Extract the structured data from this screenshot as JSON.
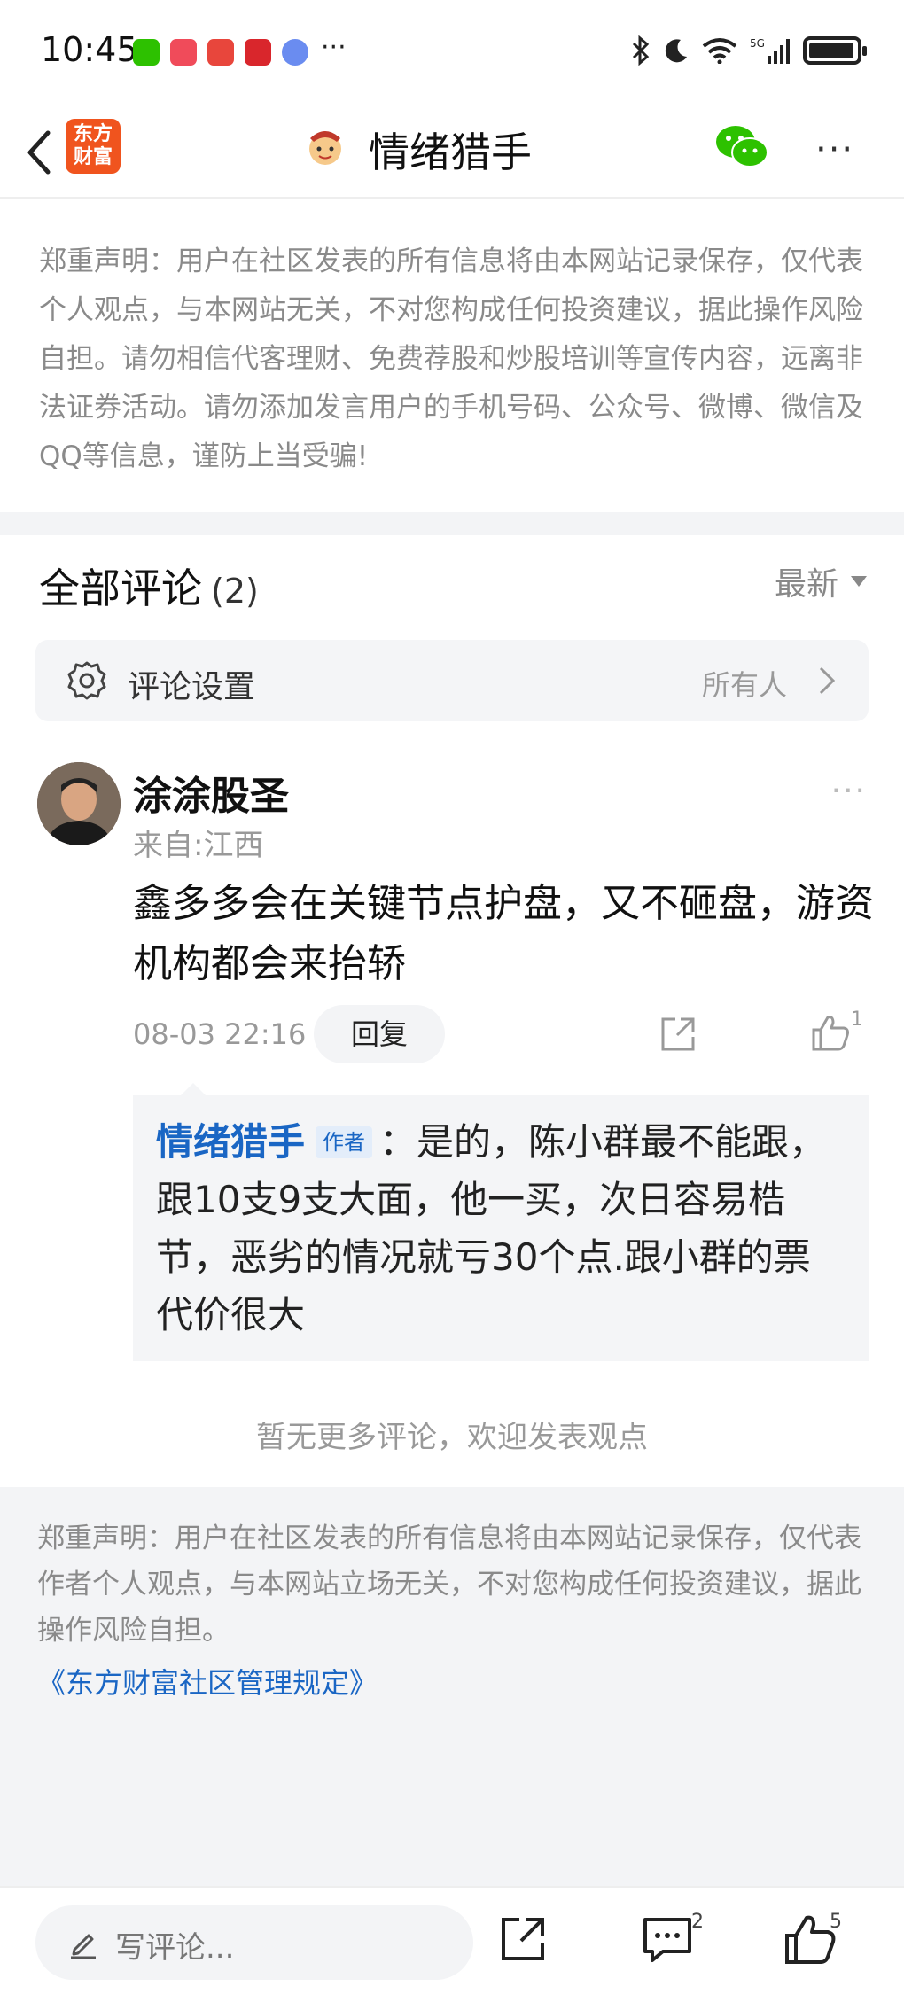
{
  "status_bar": {
    "time": "10:45",
    "more": "···",
    "network": "5G"
  },
  "nav": {
    "logo_text": "东方财富",
    "title": "情绪猎手",
    "more": "···"
  },
  "disclaimer_top": "郑重声明：用户在社区发表的所有信息将由本网站记录保存，仅代表个人观点，与本网站无关，不对您构成任何投资建议，据此操作风险自担。请勿相信代客理财、免费荐股和炒股培训等宣传内容，远离非法证券活动。请勿添加发言用户的手机号码、公众号、微博、微信及QQ等信息，谨防上当受骗!",
  "comments_header": {
    "title": "全部评论",
    "count": "(2)",
    "sort": "最新"
  },
  "comment_settings": {
    "label": "评论设置",
    "value": "所有人"
  },
  "comment": {
    "username": "涂涂股圣",
    "location": "来自:江西",
    "text": "鑫多多会在关键节点护盘，又不砸盘，游资机构都会来抬轿",
    "time": "08-03 22:16",
    "reply_label": "回复",
    "like_count": "1",
    "more": "···"
  },
  "reply": {
    "author": "情绪猎手",
    "tag": "作者",
    "text": "：是的，陈小群最不能跟，跟10支9支大面，他一买，次日容易梏节，恶劣的情况就亏30个点.跟小群的票代价很大"
  },
  "no_more_text": "暂无更多评论，欢迎发表观点",
  "disclaimer_bottom": "郑重声明：用户在社区发表的所有信息将由本网站记录保存，仅代表作者个人观点，与本网站立场无关，不对您构成任何投资建议，据此操作风险自担。",
  "rules_link": "《东方财富社区管理规定》",
  "bottom_bar": {
    "write_placeholder": "写评论...",
    "comment_count": "2",
    "like_count": "5"
  },
  "colors": {
    "accent_blue": "#1a66c4",
    "brand_orange": "#f0541e",
    "wechat_green": "#2dc100"
  }
}
